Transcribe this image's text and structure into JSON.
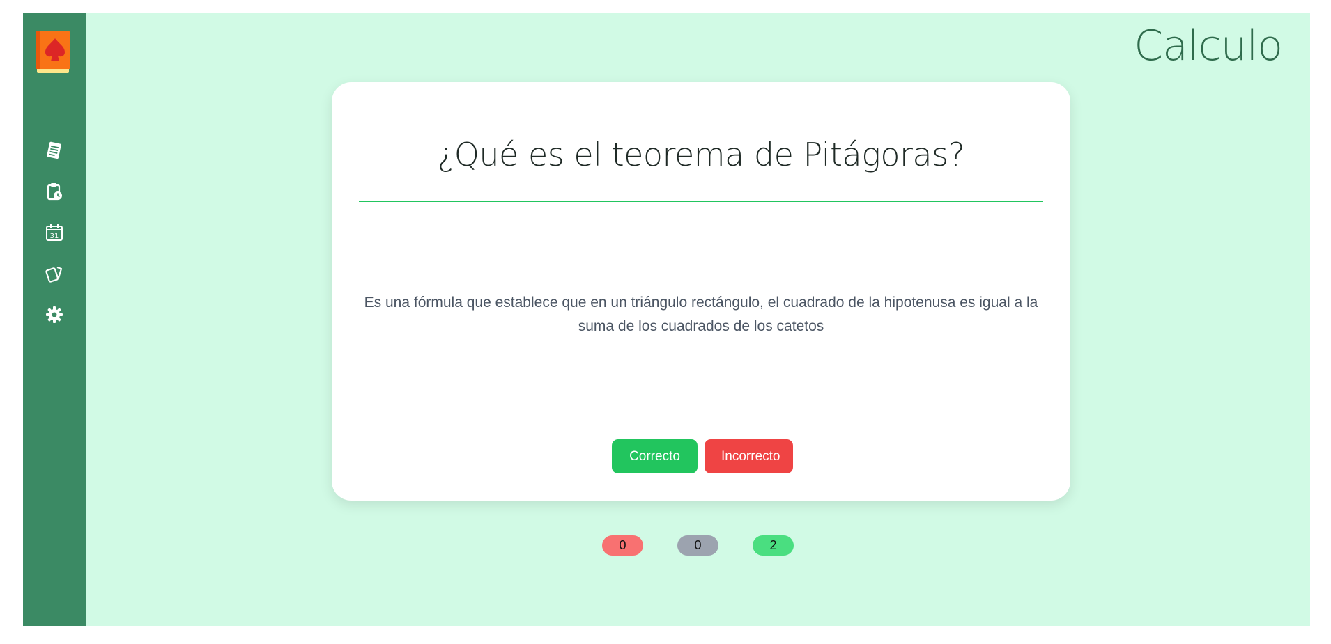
{
  "app": {
    "logo_icon": "spade-card-deck-icon"
  },
  "sidebar": {
    "items": [
      {
        "icon": "notes-icon"
      },
      {
        "icon": "clipboard-clock-icon"
      },
      {
        "icon": "calendar-31-icon"
      },
      {
        "icon": "cards-icon"
      },
      {
        "icon": "gear-icon"
      }
    ]
  },
  "header": {
    "title": "Calculo"
  },
  "card": {
    "question": "¿Qué es el teorema de Pitágoras?",
    "answer": "Es una fórmula que establece que en un triángulo rectángulo, el cuadrado de la hipotenusa es igual a la suma de los cuadrados de los catetos",
    "correct_label": "Correcto",
    "incorrect_label": "Incorrecto"
  },
  "counters": {
    "incorrect": "0",
    "pending": "0",
    "correct": "2"
  },
  "colors": {
    "sidebar": "#3b8a64",
    "background": "#d1fae5",
    "accent_green": "#22c55e",
    "accent_red": "#ef4444"
  }
}
